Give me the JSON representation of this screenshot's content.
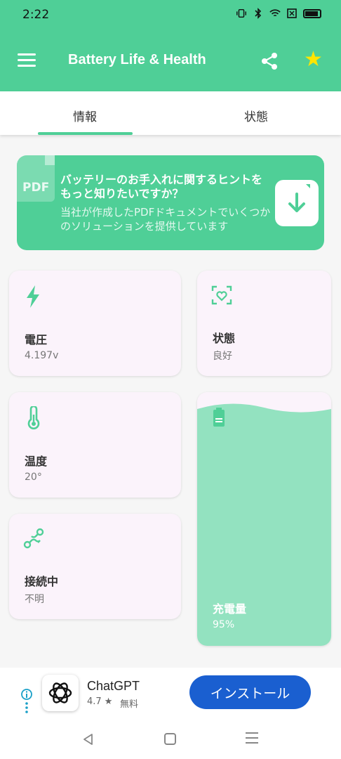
{
  "status_bar": {
    "time": "2:22",
    "icons": [
      "vibrate-icon",
      "bluetooth-icon",
      "wifi-icon",
      "sim-icon",
      "battery-icon"
    ]
  },
  "app_bar": {
    "title": "Battery Life & Health",
    "menu_icon": "hamburger-icon",
    "share_icon": "share-icon",
    "star_icon": "star-icon",
    "accent_color": "#4fcf97",
    "star_color": "#ffe500"
  },
  "tabs": [
    {
      "label": "情報",
      "selected": true
    },
    {
      "label": "状態",
      "selected": false
    }
  ],
  "banner": {
    "pdf_label": "PDF",
    "title": "バッテリーのお手入れに関するヒントをもっと知りたいですか？",
    "description": "当社が作成したPDFドキュメントでいくつかのソリューションを提供しています",
    "download_icon": "download-icon"
  },
  "cards": {
    "voltage": {
      "label": "電圧",
      "value": "4.197v",
      "icon": "bolt-icon"
    },
    "state": {
      "label": "状態",
      "value": "良好",
      "icon": "heart-scan-icon"
    },
    "temperature": {
      "label": "温度",
      "value": "20°",
      "icon": "thermometer-icon"
    },
    "connection": {
      "label": "接続中",
      "value": "不明",
      "icon": "connection-icon"
    },
    "charge": {
      "label": "充電量",
      "value": "95%",
      "icon": "battery-level-icon",
      "level": 0.95
    }
  },
  "ad": {
    "app_name": "ChatGPT",
    "rating": "4.7 ★",
    "price": "無料",
    "install_label": "インストール",
    "install_color": "#1a5fd0"
  },
  "nav_bar": {
    "icons": [
      "back-icon",
      "home-icon",
      "recents-icon"
    ]
  }
}
